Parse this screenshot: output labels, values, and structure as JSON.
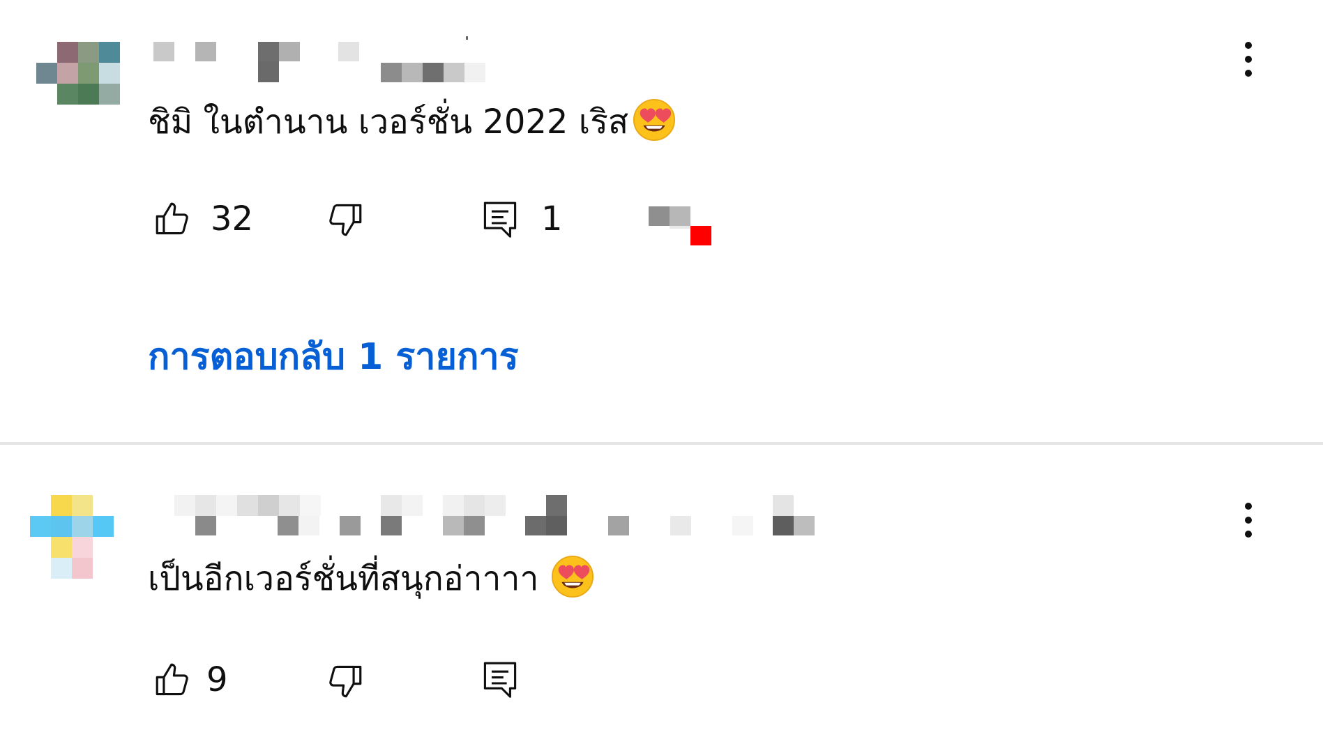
{
  "comments": [
    {
      "text": "ชิมิ ในตำนาน เวอร์ชั่น 2022 เริส",
      "emoji": "smiling-face-with-heart-eyes",
      "like_count": "32",
      "reply_count": "1",
      "replies_link_label": "การตอบกลับ 1 รายการ"
    },
    {
      "text": "เป็นอีกเวอร์ชั่นที่สนุกอ่าาาา",
      "emoji": "smiling-face-with-heart-eyes",
      "like_count": "9",
      "reply_count": ""
    }
  ],
  "colors": {
    "link": "#065fd4",
    "text": "#0f0f0f",
    "divider": "#e5e5e5",
    "badge": "#ff0000"
  },
  "icons": [
    "like-icon",
    "dislike-icon",
    "reply-icon",
    "more-vert-icon",
    "heart-eyes-emoji"
  ]
}
